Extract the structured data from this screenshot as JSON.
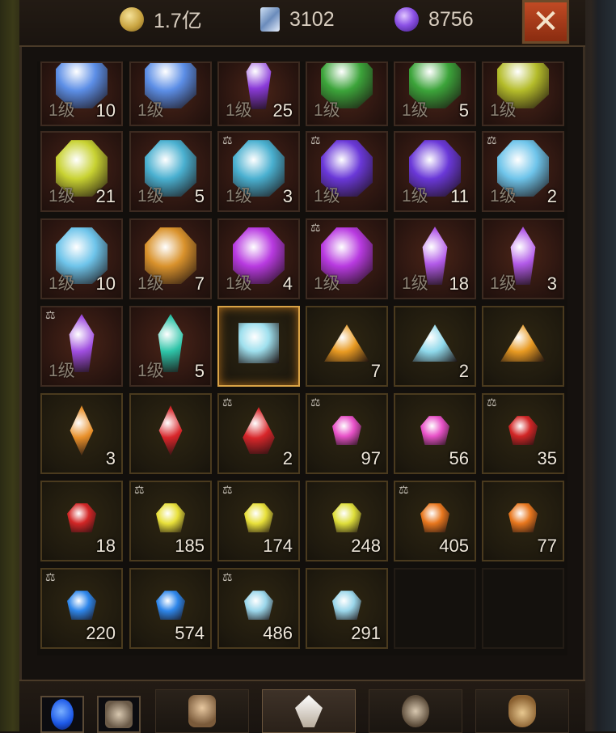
{
  "currencies": [
    {
      "name": "gold-coin-icon",
      "value": "1.7亿"
    },
    {
      "name": "scroll-icon",
      "value": "3102"
    },
    {
      "name": "purple-orb-icon",
      "value": "8756"
    }
  ],
  "close_label": "✕",
  "level_label": "1级",
  "inventory": [
    {
      "row": 0,
      "col": 0,
      "icon": "blue-crystal-cluster-icon",
      "level": true,
      "qty": "10",
      "bound": false,
      "color": "#5c8ee6"
    },
    {
      "row": 0,
      "col": 1,
      "icon": "blue-crystal-cluster-icon",
      "level": true,
      "qty": "",
      "bound": false,
      "color": "#5c8ee6"
    },
    {
      "row": 0,
      "col": 2,
      "icon": "purple-shard-cluster-icon",
      "level": true,
      "qty": "25",
      "bound": false,
      "color": "#8a3ad8"
    },
    {
      "row": 0,
      "col": 3,
      "icon": "green-eye-stone-icon",
      "level": true,
      "qty": "",
      "bound": false,
      "color": "#3ca43a"
    },
    {
      "row": 0,
      "col": 4,
      "icon": "green-eye-stone-icon",
      "level": true,
      "qty": "5",
      "bound": false,
      "color": "#3ca43a"
    },
    {
      "row": 0,
      "col": 5,
      "icon": "yellow-green-orb-icon",
      "level": true,
      "qty": "",
      "bound": false,
      "color": "#b4bc2a"
    },
    {
      "row": 1,
      "col": 0,
      "icon": "yellow-green-egg-icon",
      "level": true,
      "qty": "21",
      "bound": false,
      "color": "#c8d232"
    },
    {
      "row": 1,
      "col": 1,
      "icon": "cyan-lattice-stone-icon",
      "level": true,
      "qty": "5",
      "bound": false,
      "color": "#4ab0d0"
    },
    {
      "row": 1,
      "col": 2,
      "icon": "cyan-lattice-stone-icon",
      "level": true,
      "qty": "3",
      "bound": true,
      "color": "#4ab0d0"
    },
    {
      "row": 1,
      "col": 3,
      "icon": "violet-caged-crystal-icon",
      "level": true,
      "qty": "",
      "bound": true,
      "color": "#6a38d8"
    },
    {
      "row": 1,
      "col": 4,
      "icon": "violet-caged-crystal-icon",
      "level": true,
      "qty": "11",
      "bound": false,
      "color": "#6a38d8"
    },
    {
      "row": 1,
      "col": 5,
      "icon": "ice-blue-cluster-icon",
      "level": true,
      "qty": "2",
      "bound": true,
      "color": "#6ec4ea"
    },
    {
      "row": 2,
      "col": 0,
      "icon": "ice-blue-cluster-icon",
      "level": true,
      "qty": "10",
      "bound": false,
      "color": "#6ec4ea"
    },
    {
      "row": 2,
      "col": 1,
      "icon": "amber-rune-stone-icon",
      "level": true,
      "qty": "7",
      "bound": false,
      "color": "#d9922c"
    },
    {
      "row": 2,
      "col": 2,
      "icon": "magenta-flame-crystal-icon",
      "level": true,
      "qty": "4",
      "bound": false,
      "color": "#b83ae0"
    },
    {
      "row": 2,
      "col": 3,
      "icon": "magenta-flame-crystal-icon",
      "level": true,
      "qty": "",
      "bound": true,
      "color": "#b83ae0"
    },
    {
      "row": 2,
      "col": 4,
      "icon": "purple-shard-icon",
      "level": true,
      "qty": "18",
      "bound": false,
      "color": "#b25ae8"
    },
    {
      "row": 2,
      "col": 5,
      "icon": "purple-shard-icon",
      "level": true,
      "qty": "3",
      "bound": false,
      "color": "#b25ae8"
    },
    {
      "row": 3,
      "col": 0,
      "icon": "purple-shard-icon",
      "level": true,
      "qty": "",
      "bound": true,
      "color": "#a04ee0"
    },
    {
      "row": 3,
      "col": 1,
      "icon": "teal-shard-icon",
      "level": true,
      "qty": "5",
      "bound": false,
      "color": "#2ec4a8"
    },
    {
      "row": 3,
      "col": 2,
      "icon": "square-diamond-icon",
      "level": false,
      "qty": "",
      "bound": false,
      "color": "#9fe0ee",
      "selected": true
    },
    {
      "row": 3,
      "col": 3,
      "icon": "amber-triangle-gem-icon",
      "level": false,
      "qty": "7",
      "bound": false,
      "color": "#e89a22"
    },
    {
      "row": 3,
      "col": 4,
      "icon": "ice-triangle-gem-icon",
      "level": false,
      "qty": "2",
      "bound": false,
      "color": "#8ed8ea"
    },
    {
      "row": 3,
      "col": 5,
      "icon": "amber-triangle-gem-icon",
      "level": false,
      "qty": "",
      "bound": false,
      "color": "#e89a22"
    },
    {
      "row": 4,
      "col": 0,
      "icon": "amber-marquise-gem-icon",
      "level": false,
      "qty": "3",
      "bound": false,
      "color": "#e8902a"
    },
    {
      "row": 4,
      "col": 1,
      "icon": "ruby-marquise-gem-icon",
      "level": false,
      "qty": "",
      "bound": false,
      "color": "#d8262a"
    },
    {
      "row": 4,
      "col": 2,
      "icon": "ruby-teardrop-gem-icon",
      "level": false,
      "qty": "2",
      "bound": true,
      "color": "#d8262a"
    },
    {
      "row": 4,
      "col": 3,
      "icon": "pink-gem-icon",
      "level": false,
      "qty": "97",
      "bound": true,
      "color": "#e852c8"
    },
    {
      "row": 4,
      "col": 4,
      "icon": "pink-gem-icon",
      "level": false,
      "qty": "56",
      "bound": false,
      "color": "#e852c8"
    },
    {
      "row": 4,
      "col": 5,
      "icon": "red-gem-icon",
      "level": false,
      "qty": "35",
      "bound": true,
      "color": "#d22626"
    },
    {
      "row": 5,
      "col": 0,
      "icon": "red-gem-icon",
      "level": false,
      "qty": "18",
      "bound": false,
      "color": "#d22626"
    },
    {
      "row": 5,
      "col": 1,
      "icon": "yellow-gem-icon",
      "level": false,
      "qty": "185",
      "bound": true,
      "color": "#e8e03a"
    },
    {
      "row": 5,
      "col": 2,
      "icon": "yellow-gem-icon",
      "level": false,
      "qty": "174",
      "bound": true,
      "color": "#e8e03a"
    },
    {
      "row": 5,
      "col": 3,
      "icon": "yellow-gem-icon",
      "level": false,
      "qty": "248",
      "bound": false,
      "color": "#dede3a"
    },
    {
      "row": 5,
      "col": 4,
      "icon": "orange-gem-icon",
      "level": false,
      "qty": "405",
      "bound": true,
      "color": "#e8771e"
    },
    {
      "row": 5,
      "col": 5,
      "icon": "orange-gem-icon",
      "level": false,
      "qty": "77",
      "bound": false,
      "color": "#e8771e"
    },
    {
      "row": 6,
      "col": 0,
      "icon": "blue-gem-icon",
      "level": false,
      "qty": "220",
      "bound": true,
      "color": "#2e86ea"
    },
    {
      "row": 6,
      "col": 1,
      "icon": "blue-gem-icon",
      "level": false,
      "qty": "574",
      "bound": false,
      "color": "#2e86ea"
    },
    {
      "row": 6,
      "col": 2,
      "icon": "pale-blue-gem-icon",
      "level": false,
      "qty": "486",
      "bound": true,
      "color": "#9ad6ea"
    },
    {
      "row": 6,
      "col": 3,
      "icon": "pale-blue-gem-icon",
      "level": false,
      "qty": "291",
      "bound": false,
      "color": "#9ad6ea"
    },
    {
      "row": 6,
      "col": 4,
      "icon": "",
      "level": false,
      "qty": "",
      "bound": false,
      "color": "",
      "empty": true
    },
    {
      "row": 6,
      "col": 5,
      "icon": "",
      "level": false,
      "qty": "",
      "bound": false,
      "color": "",
      "empty": true
    }
  ],
  "bottom_buttons": [
    {
      "name": "blue-orb-button-icon",
      "color": "#1e5ae8"
    },
    {
      "name": "minotaur-button-icon",
      "color": "#c8b8a0"
    }
  ],
  "bottom_tabs": [
    {
      "name": "tab-helmet",
      "icon": "helmet-icon",
      "color": "#c8a880",
      "active": false
    },
    {
      "name": "tab-gems",
      "icon": "crystal-icon",
      "color": "#e8dccc",
      "active": true
    },
    {
      "name": "tab-dragon",
      "icon": "dragon-icon",
      "color": "#bca890",
      "active": false
    },
    {
      "name": "tab-bag",
      "icon": "bag-icon",
      "color": "#c8a070",
      "active": false
    }
  ]
}
